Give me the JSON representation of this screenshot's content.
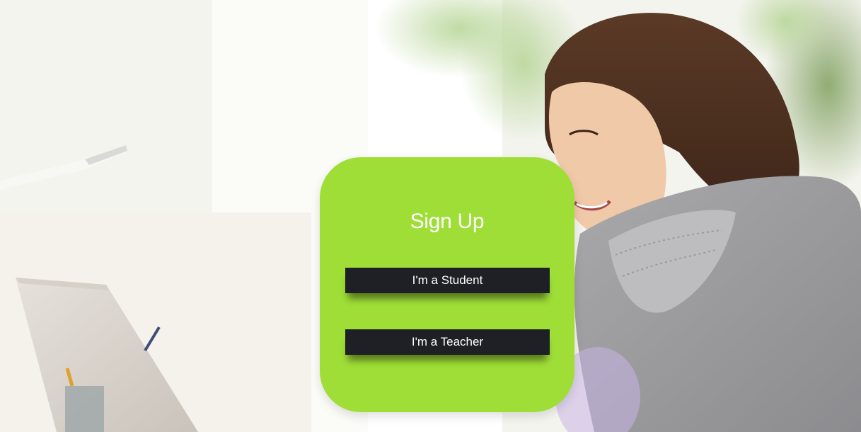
{
  "signup": {
    "title": "Sign Up",
    "student_label": "I'm a Student",
    "teacher_label": "I'm a Teacher"
  },
  "colors": {
    "card": "#9fde37",
    "button": "#1f2025",
    "text": "#ffffff"
  }
}
